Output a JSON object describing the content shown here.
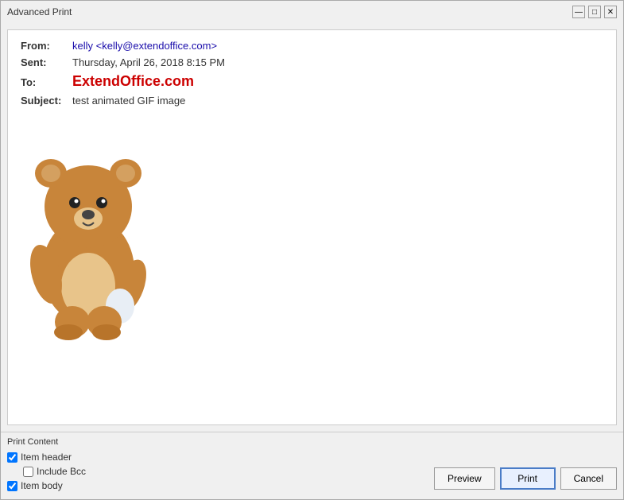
{
  "window": {
    "title": "Advanced Print",
    "minimize_label": "—",
    "maximize_label": "□",
    "close_label": "✕"
  },
  "email": {
    "from_label": "From:",
    "from_value": "kelly <kelly@extendoffice.com>",
    "sent_label": "Sent:",
    "sent_value": "Thursday, April 26, 2018 8:15 PM",
    "to_label": "To:",
    "to_value": "ExtendOffice.com",
    "subject_label": "Subject:",
    "subject_value": "test animated GIF image"
  },
  "print_content": {
    "title": "Print Content",
    "item_header_label": "Item header",
    "item_header_checked": true,
    "include_bcc_label": "Include Bcc",
    "include_bcc_checked": false,
    "item_body_label": "Item body",
    "item_body_checked": true
  },
  "buttons": {
    "preview_label": "Preview",
    "print_label": "Print",
    "cancel_label": "Cancel"
  }
}
